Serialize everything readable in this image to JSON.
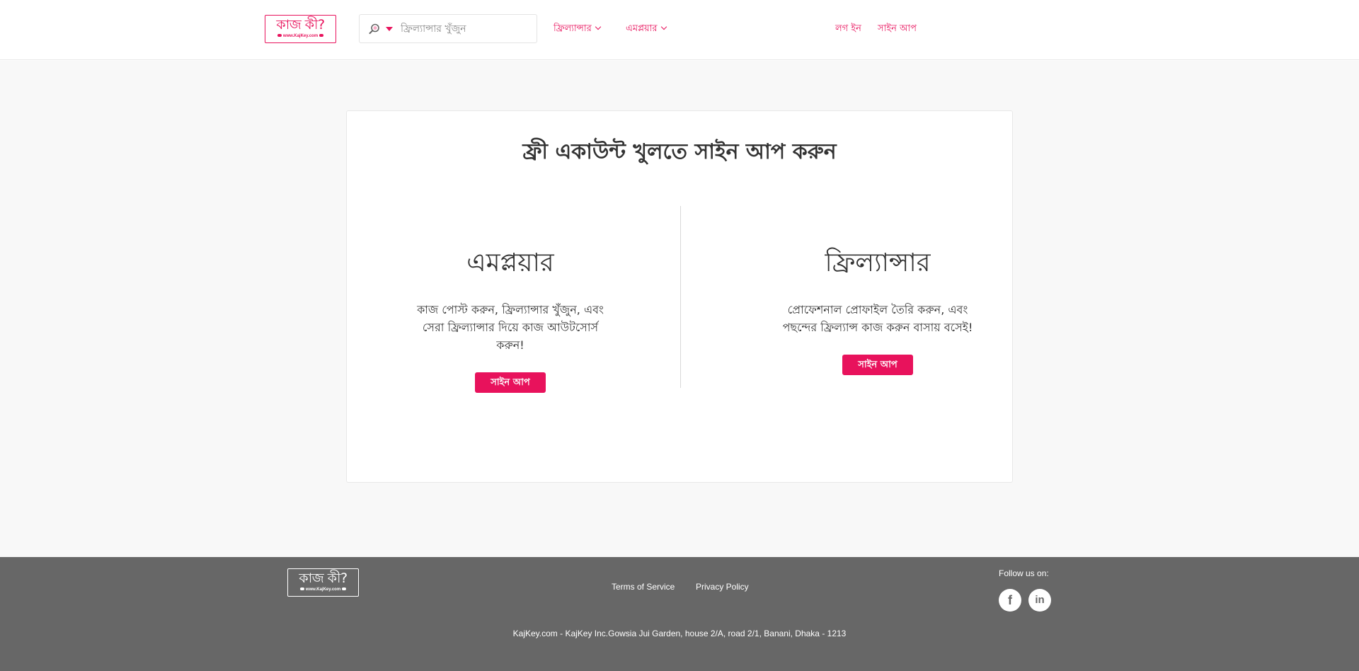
{
  "brand": {
    "logo_text": "কাজ কী?",
    "logo_url_text": "www.KajKey.com"
  },
  "header": {
    "search": {
      "placeholder": "ফ্রিল্যান্সার খুঁজুন",
      "icon": "search-icon",
      "dropdown_icon": "caret-down-icon"
    },
    "nav": {
      "freelancer_label": "ফ্রিল্যান্সার",
      "employer_label": "এমপ্লয়ার",
      "login_label": "লগ ইন",
      "signup_label": "সাইন আপ"
    }
  },
  "main": {
    "title": "ফ্রী একাউন্ট খুলতে সাইন আপ করুন",
    "employer": {
      "heading": "এমপ্লয়ার",
      "description": "কাজ পোস্ট করুন, ফ্রিল্যান্সার খুঁজুন, এবং সেরা ফ্রিল্যান্সার দিয়ে কাজ আউটসোর্স করুন!",
      "button_label": "সাইন আপ"
    },
    "freelancer": {
      "heading": "ফ্রিল্যান্সার",
      "description": "প্রোফেশনাল প্রোফাইল তৈরি করুন, এবং পছন্দের ফ্রিল্যান্স কাজ করুন বাসায় বসেই!",
      "button_label": "সাইন আপ"
    }
  },
  "footer": {
    "terms_label": "Terms of Service",
    "privacy_label": "Privacy Policy",
    "follow_label": "Follow us on:",
    "social": [
      {
        "name": "facebook-icon",
        "glyph": "f"
      },
      {
        "name": "linkedin-icon",
        "glyph": "in"
      }
    ],
    "address": "KajKey.com - KajKey Inc.Gowsia Jui Garden, house 2/A, road 2/1, Banani, Dhaka - 1213"
  },
  "colors": {
    "accent": "#e8125c",
    "footer_bg": "#676767",
    "page_bg": "#f8f8f8"
  }
}
